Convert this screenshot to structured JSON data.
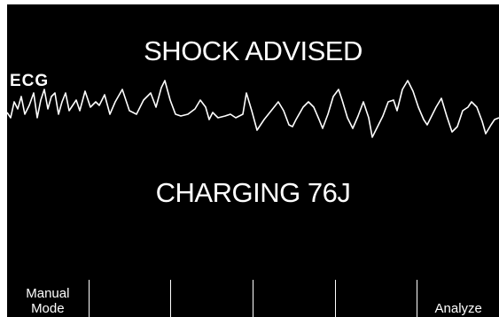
{
  "screen": {
    "advisory": "SHOCK ADVISED",
    "ecg_label": "ECG",
    "status": "CHARGING 76J"
  },
  "softkeys": [
    {
      "label": "Manual\nMode"
    },
    {
      "label": ""
    },
    {
      "label": ""
    },
    {
      "label": ""
    },
    {
      "label": ""
    },
    {
      "label": "Analyze"
    }
  ],
  "colors": {
    "background": "#000000",
    "foreground": "#ffffff"
  }
}
